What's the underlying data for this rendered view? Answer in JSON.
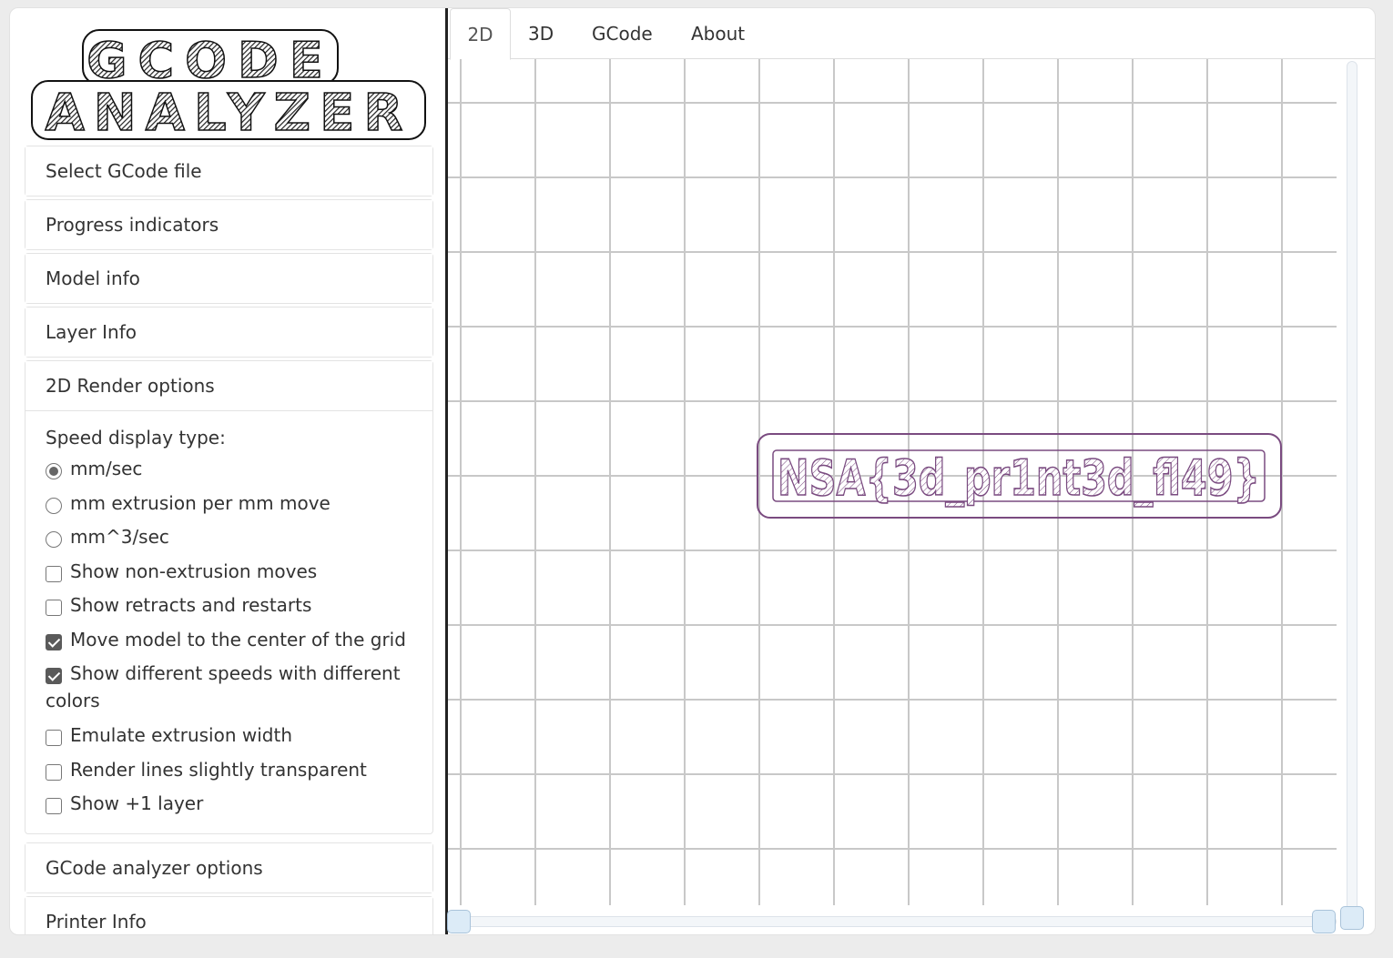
{
  "logo": {
    "line1": "GCODE",
    "line2": "ANALYZER"
  },
  "sidebar": {
    "panels": [
      {
        "label": "Select GCode file"
      },
      {
        "label": "Progress indicators"
      },
      {
        "label": "Model info"
      },
      {
        "label": "Layer Info"
      },
      {
        "label": "2D Render options"
      },
      {
        "label": "GCode analyzer options"
      },
      {
        "label": "Printer Info"
      }
    ],
    "render_options": {
      "speed_title": "Speed display type:",
      "radios": [
        {
          "label": "mm/sec",
          "checked": true
        },
        {
          "label": "mm extrusion per mm move",
          "checked": false
        },
        {
          "label": "mm^3/sec",
          "checked": false
        }
      ],
      "checkboxes": [
        {
          "label": "Show non-extrusion moves",
          "checked": false
        },
        {
          "label": "Show retracts and restarts",
          "checked": false
        },
        {
          "label": "Move model to the center of the grid",
          "checked": true
        },
        {
          "label": "Show different speeds with different colors",
          "checked": true
        },
        {
          "label": "Emulate extrusion width",
          "checked": false
        },
        {
          "label": "Render lines slightly transparent",
          "checked": false
        },
        {
          "label": "Show +1 layer",
          "checked": false
        }
      ]
    }
  },
  "tabs": [
    {
      "label": "2D",
      "active": true
    },
    {
      "label": "3D",
      "active": false
    },
    {
      "label": "GCode",
      "active": false
    },
    {
      "label": "About",
      "active": false
    }
  ],
  "render": {
    "model_text": "NSA{3d_pr1nt3d_fl49}",
    "model_color": "#7a4b80",
    "grid_color": "#c8c8c8"
  }
}
